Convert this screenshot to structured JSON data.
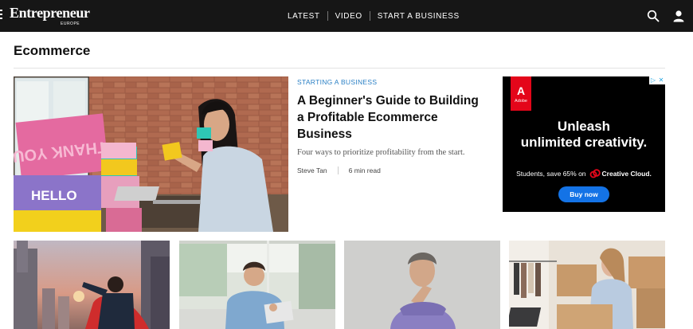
{
  "nav": {
    "logo_main": "Entrepreneur",
    "logo_sub": "EUROPE",
    "links": [
      "LATEST",
      "VIDEO",
      "START A BUSINESS"
    ],
    "icons": [
      "search-icon",
      "user-icon"
    ]
  },
  "page": {
    "title": "Ecommerce"
  },
  "hero": {
    "kicker": "STARTING A BUSINESS",
    "headline": "A Beginner's Guide to Building a Profitable Ecommerce Business",
    "dek": "Four ways to prioritize profitability from the start.",
    "author": "Steve Tan",
    "read_time": "6 min read",
    "box_texts": [
      "THANK YOU",
      "HELLO"
    ]
  },
  "ad": {
    "brand_mark": "A",
    "brand_word": "Adobe",
    "headline_line1": "Unleash",
    "headline_line2": "unlimited creativity.",
    "subtext": "Students, save 65% on",
    "product": "Creative Cloud.",
    "cta": "Buy now",
    "colors": {
      "background": "#000000",
      "adobe_red": "#e4061a",
      "button": "#1473e6"
    }
  },
  "colors": {
    "nav_bg": "#161616",
    "kicker": "#2b80c5"
  }
}
